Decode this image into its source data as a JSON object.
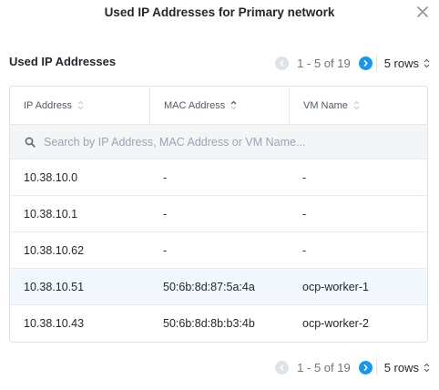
{
  "modal": {
    "title": "Used IP Addresses for Primary network"
  },
  "section": {
    "title": "Used IP Addresses"
  },
  "pagination": {
    "range": "1 - 5 of 19",
    "rows_label": "5 rows"
  },
  "table": {
    "columns": [
      {
        "label": "IP Address",
        "sort": "none"
      },
      {
        "label": "MAC Address",
        "sort": "ascending"
      },
      {
        "label": "VM Name",
        "sort": "none"
      }
    ],
    "search_placeholder": "Search by IP Address, MAC Address or VM Name...",
    "rows": [
      {
        "ip": "10.38.10.0",
        "mac": "-",
        "vm": "-"
      },
      {
        "ip": "10.38.10.1",
        "mac": "-",
        "vm": "-"
      },
      {
        "ip": "10.38.10.62",
        "mac": "-",
        "vm": "-"
      },
      {
        "ip": "10.38.10.51",
        "mac": "50:6b:8d:87:5a:4a",
        "vm": "ocp-worker-1"
      },
      {
        "ip": "10.38.10.43",
        "mac": "50:6b:8d:8b:b3:4b",
        "vm": "ocp-worker-2"
      }
    ]
  },
  "colors": {
    "accent": "#1b97ea",
    "row_highlight": "#f2f8fd",
    "search_bg": "#f3f5f7"
  },
  "icons": {
    "close": "close-icon",
    "prev": "chevron-left-icon",
    "next": "chevron-right-icon",
    "search": "search-icon",
    "sort": "sort-icon"
  }
}
